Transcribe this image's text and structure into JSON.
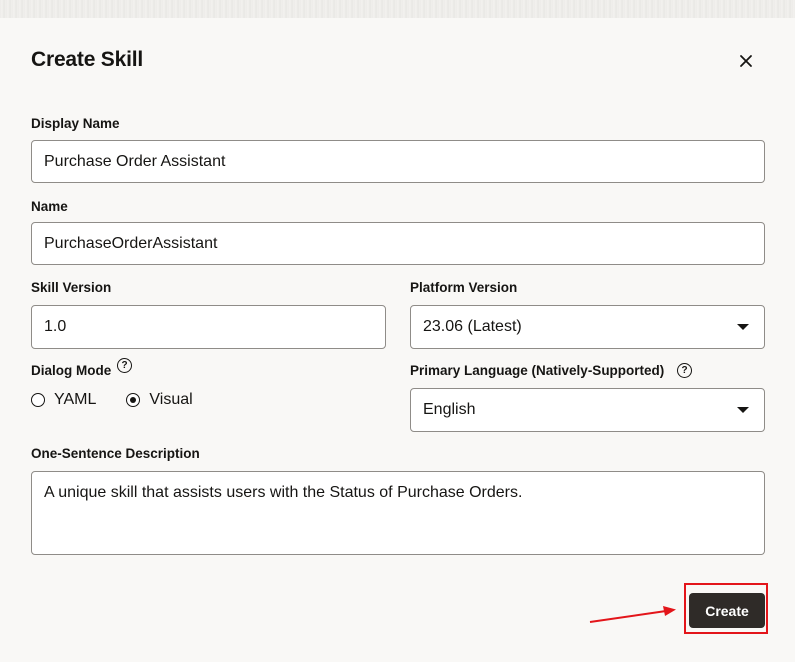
{
  "dialog": {
    "title": "Create Skill",
    "close_icon": "close-icon"
  },
  "form": {
    "display_name": {
      "label": "Display Name",
      "value": "Purchase Order Assistant"
    },
    "name": {
      "label": "Name",
      "value": "PurchaseOrderAssistant"
    },
    "skill_version": {
      "label": "Skill Version",
      "value": "1.0"
    },
    "platform_version": {
      "label": "Platform Version",
      "value": "23.06 (Latest)"
    },
    "dialog_mode": {
      "label": "Dialog Mode",
      "help_icon": "?",
      "options": [
        {
          "label": "YAML",
          "selected": false
        },
        {
          "label": "Visual",
          "selected": true
        }
      ]
    },
    "primary_language": {
      "label": "Primary Language (Natively-Supported)",
      "help_icon": "?",
      "value": "English"
    },
    "description": {
      "label": "One-Sentence Description",
      "value": "A unique skill that assists users with the Status of Purchase Orders."
    }
  },
  "actions": {
    "create_label": "Create"
  },
  "colors": {
    "highlight": "#e3151a",
    "button_bg": "#2f2b28",
    "dialog_bg": "#f9f8f6"
  }
}
